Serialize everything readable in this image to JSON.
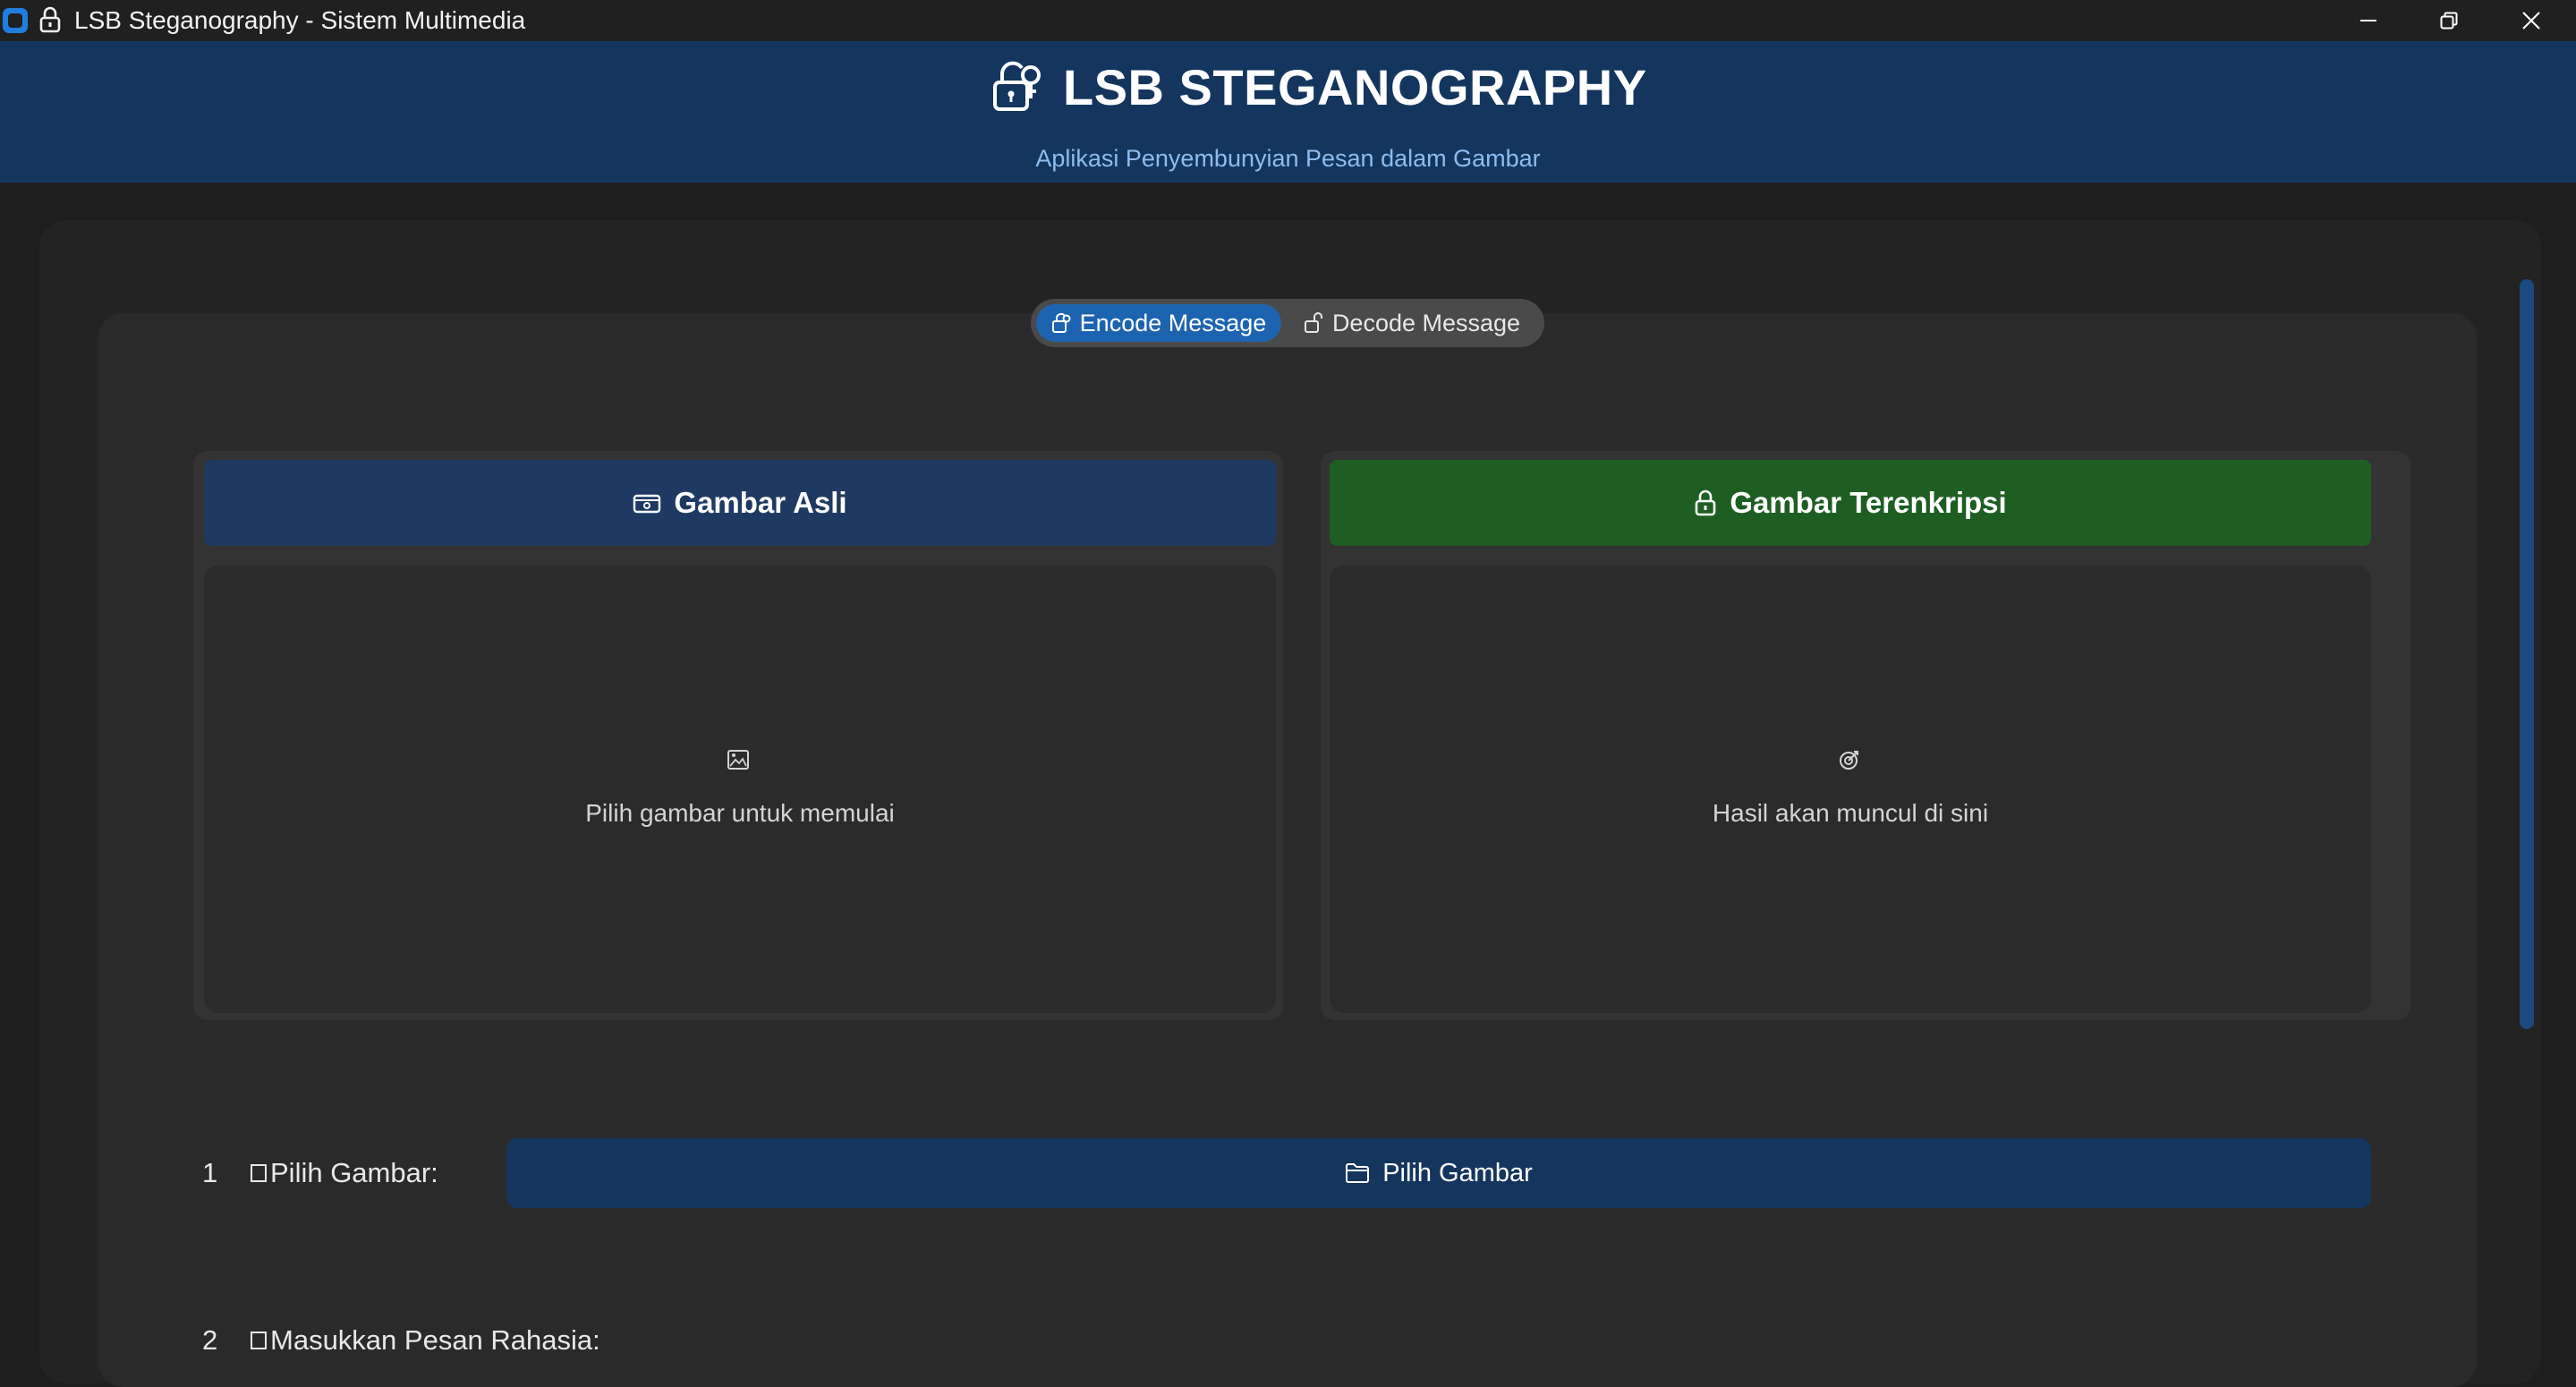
{
  "window": {
    "title": "LSB Steganography - Sistem Multimedia",
    "controls": [
      "minimize-icon",
      "restore-icon",
      "close-icon"
    ]
  },
  "header": {
    "title": "LSB STEGANOGRAPHY",
    "subtitle": "Aplikasi Penyembunyian Pesan dalam Gambar",
    "icon": "lock-key-icon"
  },
  "tabs": [
    {
      "label": "Encode Message",
      "icon": "lock-closed-icon",
      "active": true
    },
    {
      "label": "Decode Message",
      "icon": "lock-open-icon",
      "active": false
    }
  ],
  "panels": {
    "original": {
      "title": "Gambar Asli",
      "icon": "card-icon",
      "placeholder_icon": "image-icon",
      "placeholder": "Pilih gambar untuk memulai"
    },
    "encrypted": {
      "title": "Gambar Terenkripsi",
      "icon": "lock-closed-icon",
      "placeholder_icon": "target-icon",
      "placeholder": "Hasil akan muncul di sini"
    }
  },
  "steps": [
    {
      "number": "1",
      "label": "Pilih Gambar:"
    },
    {
      "number": "2",
      "label": "Masukkan Pesan Rahasia:"
    }
  ],
  "choose_button": {
    "label": "Pilih Gambar",
    "icon": "folder-icon"
  },
  "colors": {
    "header_bg": "#14365e",
    "subtitle": "#8dbcf0",
    "tab_active": "#1d64b0",
    "panel_original_head": "#1e3a62",
    "panel_encrypted_head": "#1e5e22",
    "scroll_thumb": "#1a4a80"
  }
}
